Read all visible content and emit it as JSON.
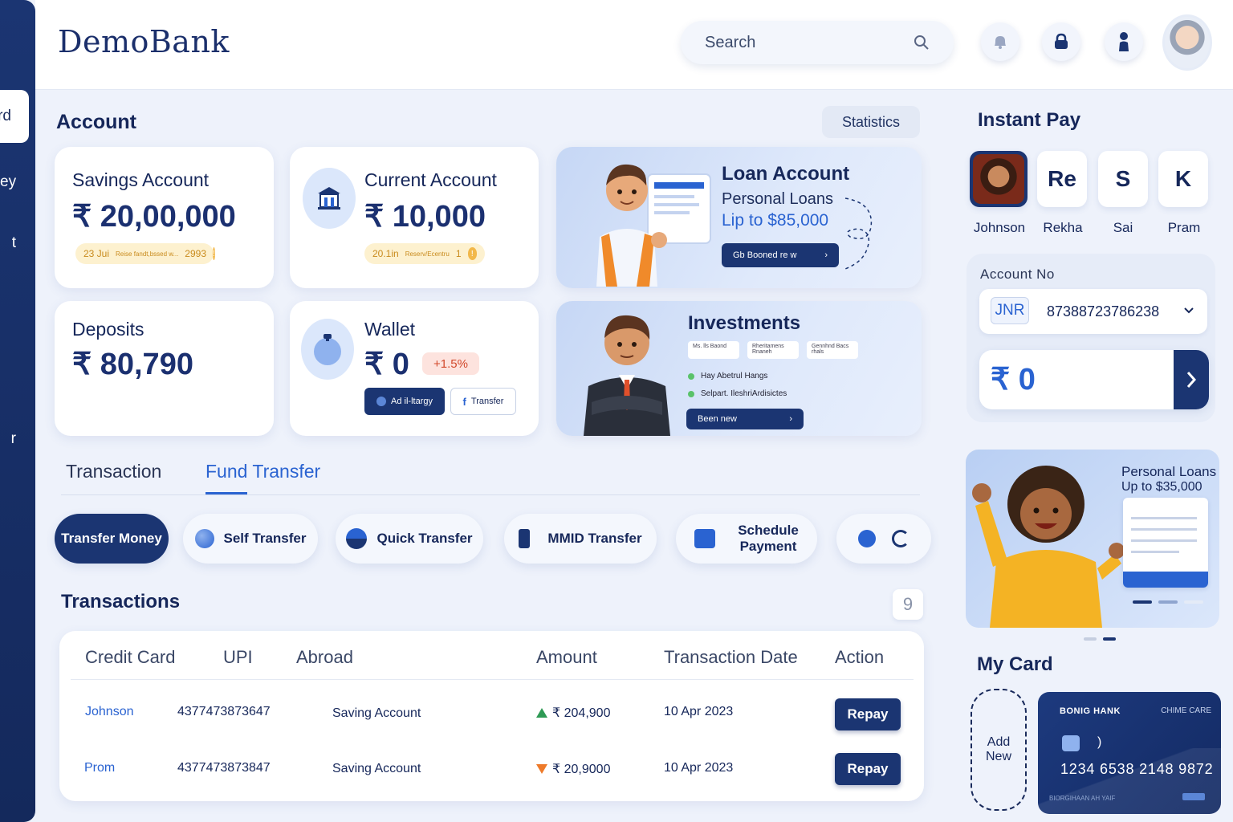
{
  "app": {
    "name": "DemoBank"
  },
  "sidebar": {
    "items": [
      {
        "label": "rd",
        "active": true
      },
      {
        "label": "ey"
      },
      {
        "label": "t"
      },
      {
        "label": "r"
      }
    ]
  },
  "header": {
    "search_placeholder": "Search"
  },
  "account": {
    "title": "Account",
    "statistics_label": "Statistics",
    "savings": {
      "label": "Savings Account",
      "amount": "₹ 20,00,000",
      "note_left": "23 Jui",
      "note_mid": "Reise fandt,bssed w...",
      "note_right": "2993"
    },
    "current": {
      "label": "Current Account",
      "amount": "₹ 10,000",
      "note_left": "20.1in",
      "note_mid": "Reserv/Ecentru",
      "note_right": "1"
    },
    "deposits": {
      "label": "Deposits",
      "amount": "₹ 80,790"
    },
    "wallet": {
      "label": "Wallet",
      "amount": "₹ 0",
      "change": "+1.5%",
      "btn_add": "Ad il-ltargy",
      "btn_transfer": "Transfer"
    }
  },
  "loan_promo": {
    "title": "Loan Account",
    "subtitle": "Personal Loans",
    "amount_text": "Lip to $85,000",
    "button": "Gb Booned re w"
  },
  "investments_promo": {
    "title": "Investments",
    "chips": [
      "Ms. lls Baond",
      "Rheritamens Rnaneh",
      "Gennhnd Bacs rhals"
    ],
    "items": [
      "Hay Abetrul Hangs",
      "Selpart. IleshriArdisictes"
    ],
    "button": "Been new"
  },
  "tabs": [
    {
      "label": "Transaction",
      "active": false
    },
    {
      "label": "Fund Transfer",
      "active": true
    }
  ],
  "transfer_actions": [
    {
      "label": "Transfer Money",
      "icon": "none"
    },
    {
      "label": "Self Transfer",
      "icon": "globe-icon"
    },
    {
      "label": "Quick Transfer",
      "icon": "circle-icon"
    },
    {
      "label": "MMID Transfer",
      "icon": "phone-icon"
    },
    {
      "label": "Schedule Payment",
      "line1": "Schedule",
      "line2": "Payment",
      "icon": "calendar-icon"
    }
  ],
  "transactions": {
    "title": "Transactions",
    "badge": "9",
    "headers": [
      "Credit Card",
      "UPI",
      "Abroad",
      "Amount",
      "Transaction Date",
      "Action"
    ],
    "rows": [
      {
        "name": "Johnson",
        "upi": "4377473873647",
        "account": "Saving Account",
        "direction": "up",
        "amount": "₹ 204,900",
        "date": "10 Apr 2023",
        "action": "Repay"
      },
      {
        "name": "Prom",
        "upi": "4377473873847",
        "account": "Saving Account",
        "direction": "down",
        "amount": "₹ 20,9000",
        "date": "10 Apr 2023",
        "action": "Repay"
      }
    ]
  },
  "instant_pay": {
    "title": "Instant Pay",
    "payees": [
      {
        "initials": "",
        "name": "Johnson",
        "photo": true
      },
      {
        "initials": "Re",
        "name": "Rekha"
      },
      {
        "initials": "S",
        "name": "Sai"
      },
      {
        "initials": "K",
        "name": "Pram"
      }
    ],
    "account_label": "Account No",
    "currency": "JNR",
    "account_number": "87388723786238",
    "amount": "₹ 0"
  },
  "side_promo": {
    "title": "Personal Loans",
    "subtitle": "Up to $35,000"
  },
  "my_card": {
    "title": "My Card",
    "add_new_line1": "Add",
    "add_new_line2": "New",
    "bank_name": "BONIG HANK",
    "brand": "CHIME CARE",
    "number": "1234 6538 2148 9872",
    "holder": "BIORGIHAAN AH YAIF"
  },
  "colors": {
    "navy": "#1b3572",
    "accent_blue": "#2a63d1",
    "background": "#eef2fb"
  }
}
